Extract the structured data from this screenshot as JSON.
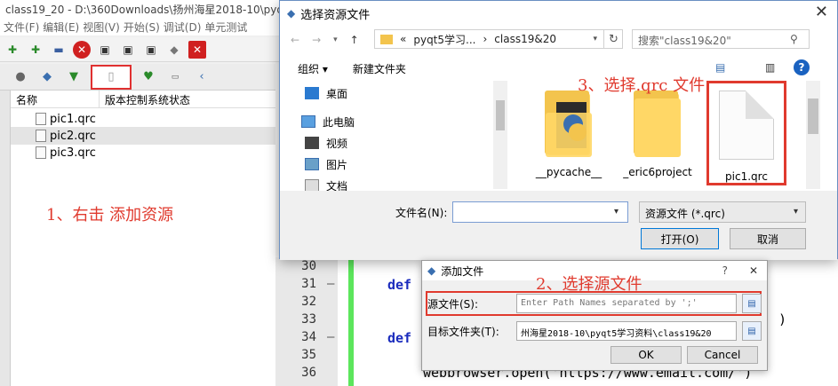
{
  "app": {
    "title": "class19_20 - D:\\360Downloads\\扬州海星2018-10\\pyqt",
    "menu": [
      "文件(F)",
      "编辑(E)",
      "视图(V)",
      "开始(S)",
      "调试(D)",
      "单元测试"
    ]
  },
  "project_panel": {
    "columns": [
      "名称",
      "版本控制系统状态"
    ],
    "files": [
      "pic1.qrc",
      "pic2.qrc",
      "pic3.qrc"
    ]
  },
  "annotations": {
    "step1": "1、右击 添加资源",
    "step2": "2、选择源文件",
    "step3": "3、选择.qrc 文件"
  },
  "editor": {
    "line_numbers": [
      "30",
      "31",
      "32",
      "33",
      "34",
      "35",
      "36"
    ],
    "fold_marks": [
      "–",
      "–"
    ],
    "code": {
      "def1": "def",
      "def2": "def",
      "close_paren": ")",
      "webbrowser": "webbrowser.open('https://www.email.com/')"
    },
    "right_fragments": [
      "ck",
      "ck",
      "ck"
    ]
  },
  "file_dialog": {
    "title": "选择资源文件",
    "close": "✕",
    "address": {
      "prefix": "«",
      "path1": "pyqt5学习...",
      "sep": "›",
      "path2": "class19&20"
    },
    "search_placeholder": "搜索\"class19&20\"",
    "commands": {
      "organize": "组织 ▾",
      "new_folder": "新建文件夹"
    },
    "nav_items": [
      "桌面",
      "此电脑",
      "视频",
      "图片",
      "文档"
    ],
    "items": [
      {
        "name": "__pycache__",
        "type": "folder"
      },
      {
        "name": "_eric6project",
        "type": "folder"
      },
      {
        "name": "pic1.qrc",
        "type": "file"
      }
    ],
    "file_name_label": "文件名(N):",
    "file_name_value": "",
    "filter_value": "资源文件 (*.qrc)",
    "open_button": "打开(O)",
    "cancel_button": "取消"
  },
  "add_file_dialog": {
    "title": "添加文件",
    "help": "?",
    "close": "✕",
    "source_label": "源文件(S):",
    "source_placeholder": "Enter Path Names separated by ';'",
    "target_label": "目标文件夹(T):",
    "target_value": "州海星2018-10\\pyqt5学习资料\\class19&20",
    "ok": "OK",
    "cancel": "Cancel"
  }
}
